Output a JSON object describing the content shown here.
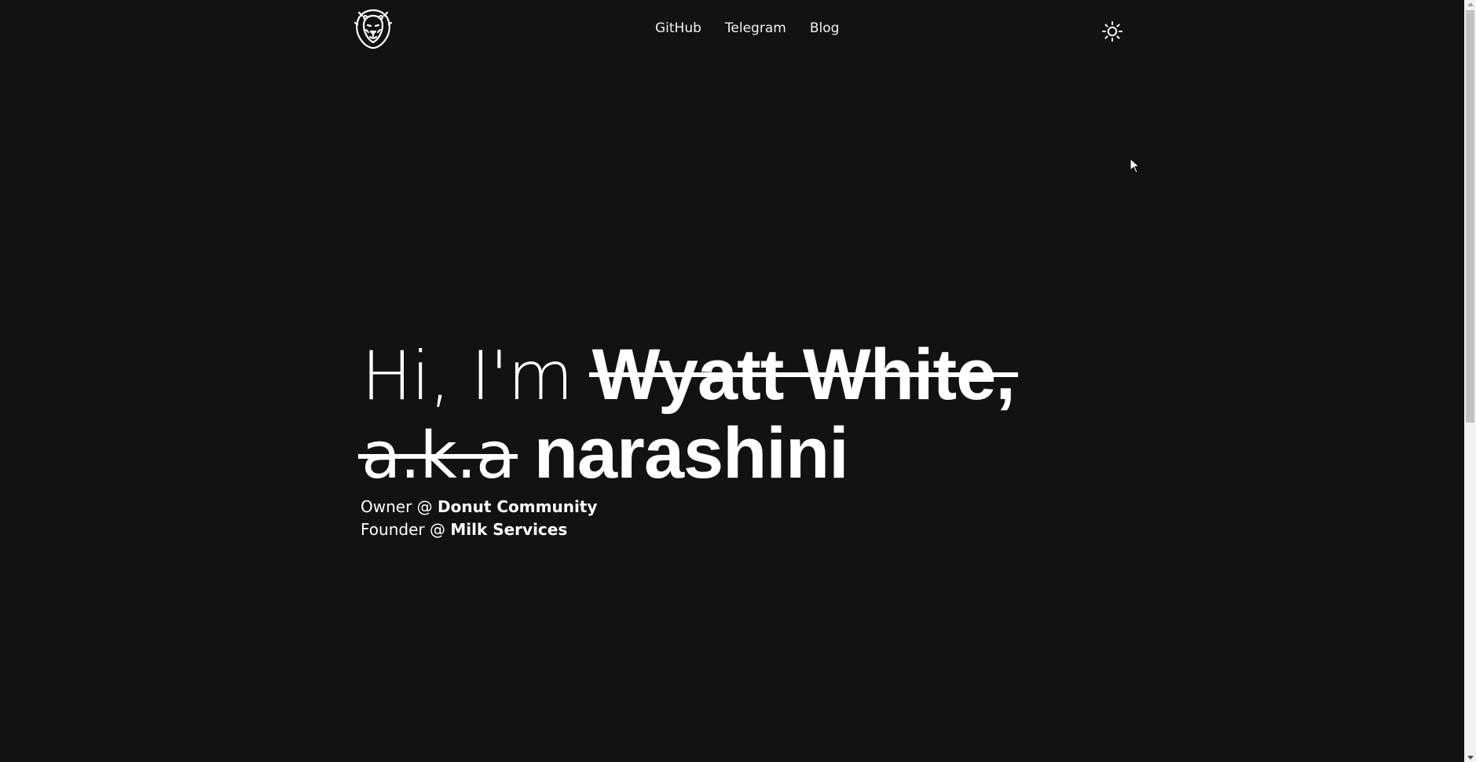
{
  "header": {
    "logo_icon": "lion-head-icon",
    "nav": [
      {
        "label": "GitHub"
      },
      {
        "label": "Telegram"
      },
      {
        "label": "Blog"
      }
    ],
    "theme_toggle_icon": "sun-icon"
  },
  "hero": {
    "greeting": "Hi, I'm",
    "struck_name": "Wyatt White",
    "comma": ",",
    "struck_aka": "a.k.a",
    "handle": "narashini"
  },
  "roles": [
    {
      "title": "Owner @",
      "org": "Donut Community"
    },
    {
      "title": "Founder @",
      "org": "Milk Services"
    }
  ],
  "colors": {
    "background": "#121212",
    "text": "#ffffff"
  }
}
